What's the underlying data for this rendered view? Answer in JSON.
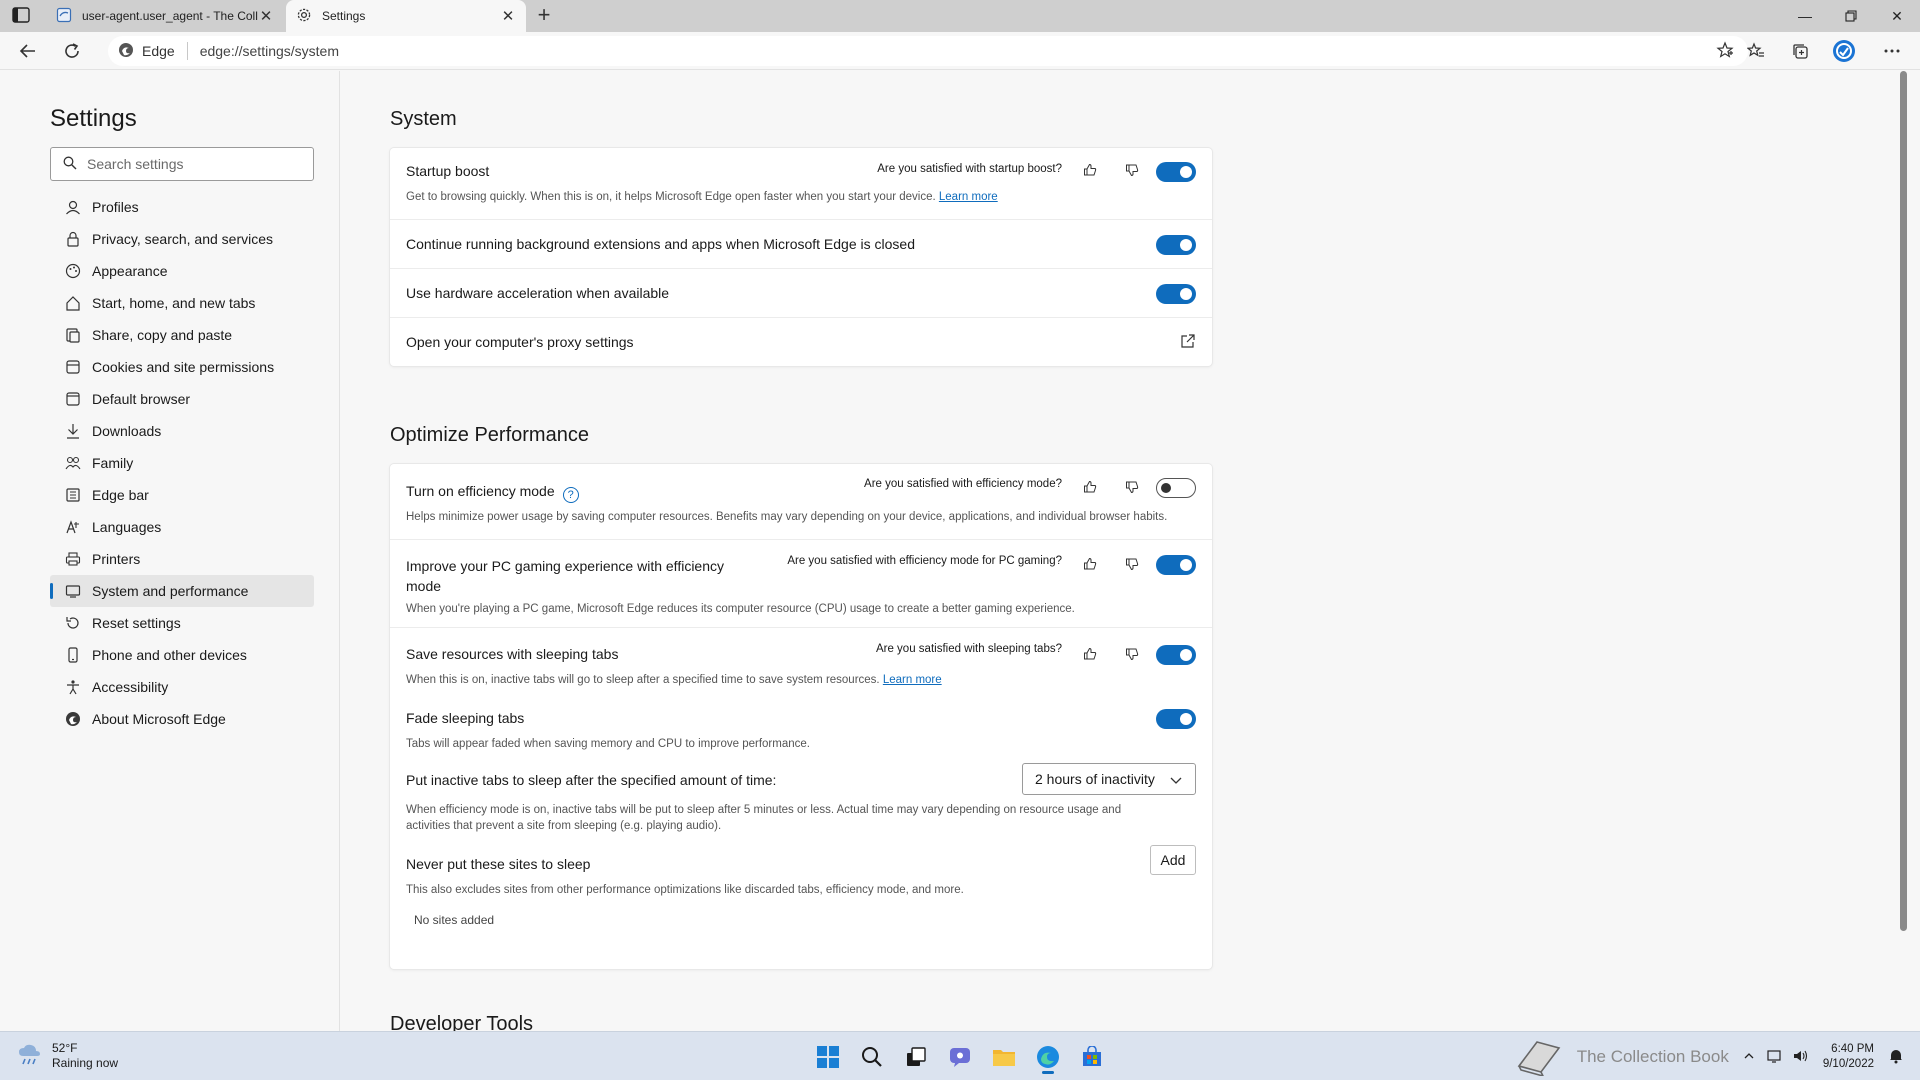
{
  "window": {
    "tabs": [
      {
        "title": "user-agent.user_agent - The Coll",
        "icon": "document-icon"
      },
      {
        "title": "Settings",
        "icon": "gear-icon"
      }
    ],
    "new_tab": "+"
  },
  "toolbar": {
    "site_name": "Edge",
    "url": "edge://settings/system"
  },
  "nav": {
    "title": "Settings",
    "search_placeholder": "Search settings",
    "items": [
      {
        "label": "Profiles",
        "icon": "profile-icon"
      },
      {
        "label": "Privacy, search, and services",
        "icon": "lock-icon"
      },
      {
        "label": "Appearance",
        "icon": "appearance-icon"
      },
      {
        "label": "Start, home, and new tabs",
        "icon": "home-icon"
      },
      {
        "label": "Share, copy and paste",
        "icon": "share-icon"
      },
      {
        "label": "Cookies and site permissions",
        "icon": "cookie-icon"
      },
      {
        "label": "Default browser",
        "icon": "browser-icon"
      },
      {
        "label": "Downloads",
        "icon": "download-icon"
      },
      {
        "label": "Family",
        "icon": "family-icon"
      },
      {
        "label": "Edge bar",
        "icon": "edge-bar-icon"
      },
      {
        "label": "Languages",
        "icon": "language-icon"
      },
      {
        "label": "Printers",
        "icon": "printer-icon"
      },
      {
        "label": "System and performance",
        "icon": "system-icon"
      },
      {
        "label": "Reset settings",
        "icon": "reset-icon"
      },
      {
        "label": "Phone and other devices",
        "icon": "phone-icon"
      },
      {
        "label": "Accessibility",
        "icon": "accessibility-icon"
      },
      {
        "label": "About Microsoft Edge",
        "icon": "edge-logo-icon"
      }
    ],
    "active_index": 12
  },
  "system": {
    "title": "System",
    "startup_boost": {
      "title": "Startup boost",
      "feedback": "Are you satisfied with startup boost?",
      "desc": "Get to browsing quickly. When this is on, it helps Microsoft Edge open faster when you start your device.",
      "link": "Learn more",
      "enabled": true
    },
    "background": {
      "title": "Continue running background extensions and apps when Microsoft Edge is closed",
      "enabled": true
    },
    "hardware": {
      "title": "Use hardware acceleration when available",
      "enabled": true
    },
    "proxy": {
      "title": "Open your computer's proxy settings"
    }
  },
  "optimize": {
    "title": "Optimize Performance",
    "efficiency": {
      "title": "Turn on efficiency mode",
      "feedback": "Are you satisfied with efficiency mode?",
      "desc": "Helps minimize power usage by saving computer resources. Benefits may vary depending on your device, applications, and individual browser habits.",
      "enabled": false
    },
    "gaming": {
      "title_line1": "Improve your PC gaming experience with efficiency",
      "title_line2": "mode",
      "feedback": "Are you satisfied with efficiency mode for PC gaming?",
      "desc": "When you're playing a PC game, Microsoft Edge reduces its computer resource (CPU) usage to create a better gaming experience.",
      "enabled": true
    },
    "sleeping_tabs": {
      "title": "Save resources with sleeping tabs",
      "feedback": "Are you satisfied with sleeping tabs?",
      "desc": "When this is on, inactive tabs will go to sleep after a specified time to save system resources.",
      "link": "Learn more",
      "enabled": true
    },
    "fade": {
      "title": "Fade sleeping tabs",
      "desc": "Tabs will appear faded when saving memory and CPU to improve performance.",
      "enabled": true
    },
    "inactive": {
      "title": "Put inactive tabs to sleep after the specified amount of time:",
      "selected": "2 hours of inactivity",
      "desc_line1": "When efficiency mode is on, inactive tabs will be put to sleep after 5 minutes or less. Actual time may vary depending on resource usage and",
      "desc_line2": "activities that prevent a site from sleeping (e.g. playing audio)."
    },
    "never_sleep": {
      "title": "Never put these sites to sleep",
      "add_label": "Add",
      "desc": "This also excludes sites from other performance optimizations like discarded tabs, efficiency mode, and more.",
      "empty": "No sites added"
    }
  },
  "next_section": "Developer Tools",
  "taskbar": {
    "temp": "52°F",
    "condition": "Raining now",
    "apps": [
      "start-icon",
      "search-icon",
      "task-view-icon",
      "chat-icon",
      "file-explorer-icon",
      "edge-icon",
      "store-icon"
    ],
    "time": "6:40 PM",
    "date": "9/10/2022",
    "watermark": "The Collection Book"
  },
  "colors": {
    "accent": "#0f6cbd",
    "tabstrip": "#cfcfcf",
    "taskbar": "#dbe3ef"
  }
}
